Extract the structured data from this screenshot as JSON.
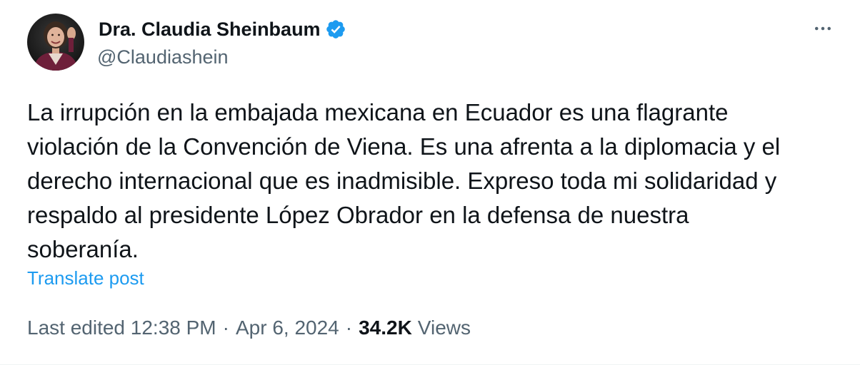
{
  "author": {
    "display_name": "Dra. Claudia Sheinbaum",
    "handle": "@Claudiashein",
    "verified_icon": "verified-badge-icon",
    "avatar_icon": "profile-photo",
    "verified_color": "#1d9bf0"
  },
  "tweet": {
    "text": "La irrupción en la embajada mexicana en Ecuador es una flagrante\nviolación de la Convención de Viena. Es una afrenta a la diplomacia y el\nderecho internacional que es inadmisible. Expreso toda mi solidaridad y\nrespaldo al presidente López Obrador en la defensa de nuestra\nsoberanía.",
    "translate_label": "Translate post"
  },
  "meta": {
    "edited_label": "Last edited",
    "time": "12:38 PM",
    "separator": "·",
    "date": "Apr 6, 2024",
    "views_count": "34.2K",
    "views_label": "Views"
  },
  "actions": {
    "more_icon": "more-options-icon"
  },
  "colors": {
    "text_primary": "#0f1419",
    "text_secondary": "#536471",
    "link": "#1d9bf0"
  }
}
